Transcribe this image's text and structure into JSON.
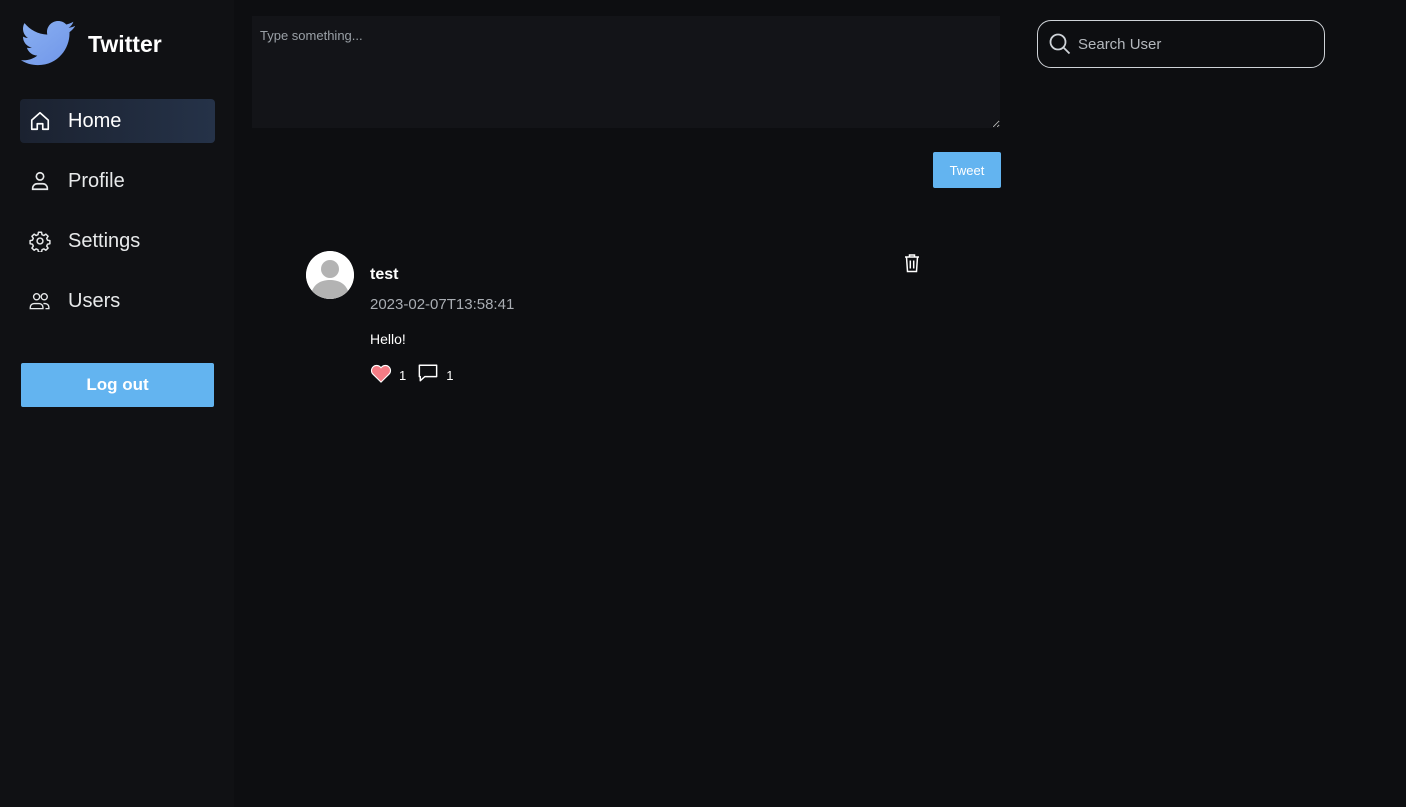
{
  "brand": {
    "title": "Twitter",
    "logo_icon": "twitter-bird-icon",
    "logo_color": "#7ba4f0"
  },
  "sidebar": {
    "items": [
      {
        "label": "Home",
        "icon": "home-icon",
        "active": true
      },
      {
        "label": "Profile",
        "icon": "user-icon",
        "active": false
      },
      {
        "label": "Settings",
        "icon": "gear-icon",
        "active": false
      },
      {
        "label": "Users",
        "icon": "users-icon",
        "active": false
      }
    ],
    "logout_label": "Log out"
  },
  "composer": {
    "placeholder": "Type something...",
    "value": "",
    "submit_label": "Tweet"
  },
  "feed": [
    {
      "username": "test",
      "timestamp": "2023-02-07T13:58:41",
      "content": "Hello!",
      "likes": "1",
      "comments": "1",
      "liked": true
    }
  ],
  "search": {
    "placeholder": "Search User",
    "value": ""
  },
  "colors": {
    "accent": "#63b4f0",
    "background": "#0d0e11",
    "sidebar": "#101114",
    "like": "#f47c85"
  }
}
